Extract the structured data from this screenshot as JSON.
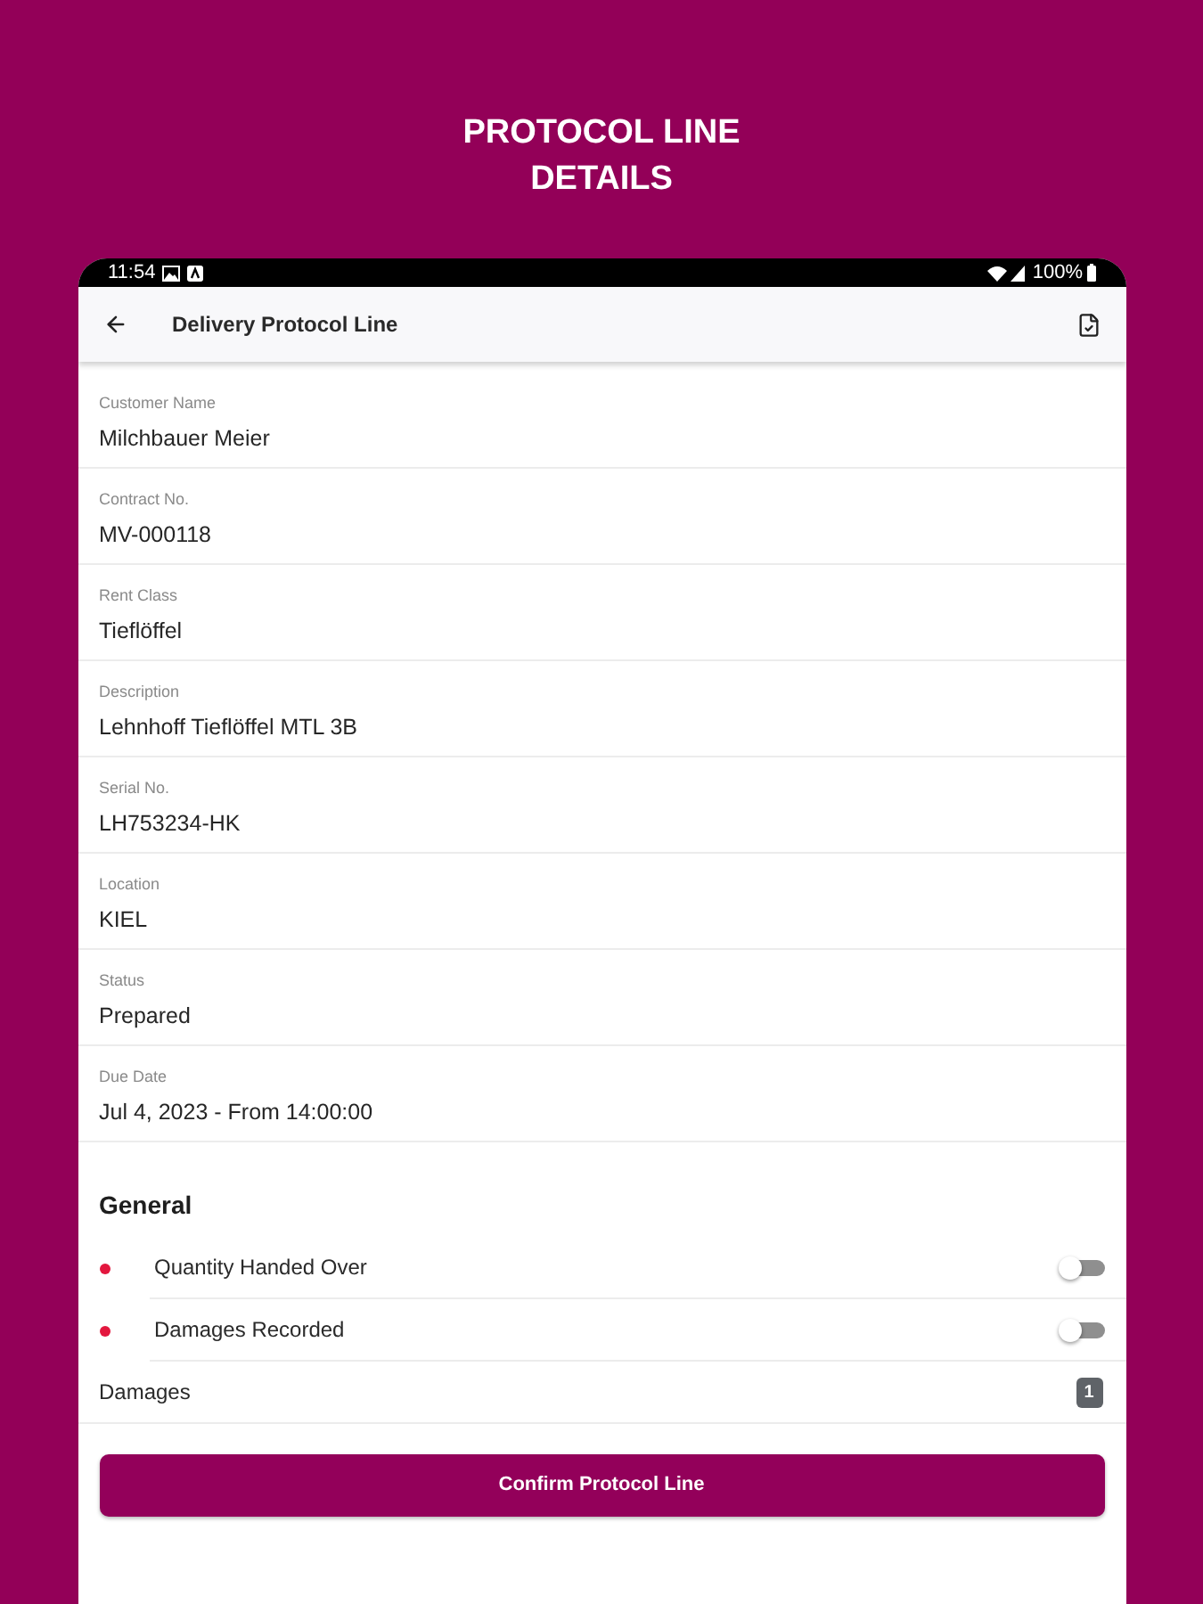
{
  "screen_title": "PROTOCOL LINE DETAILS",
  "status_bar": {
    "time": "11:54",
    "battery": "100%"
  },
  "app_bar": {
    "title": "Delivery Protocol Line"
  },
  "fields": [
    {
      "label": "Customer Name",
      "value": "Milchbauer Meier"
    },
    {
      "label": "Contract No.",
      "value": "MV-000118"
    },
    {
      "label": "Rent Class",
      "value": "Tieflöffel"
    },
    {
      "label": "Description",
      "value": "Lehnhoff Tieflöffel MTL 3B"
    },
    {
      "label": "Serial No.",
      "value": "LH753234-HK"
    },
    {
      "label": "Location",
      "value": "KIEL"
    },
    {
      "label": "Status",
      "value": "Prepared"
    },
    {
      "label": "Due Date",
      "value": "Jul 4, 2023 - From 14:00:00"
    }
  ],
  "general": {
    "heading": "General",
    "rows": [
      {
        "kind": "toggle",
        "label": "Quantity Handed Over",
        "required": true,
        "on": false
      },
      {
        "kind": "toggle",
        "label": "Damages Recorded",
        "required": true,
        "on": false
      },
      {
        "kind": "count",
        "label": "Damages",
        "count": "1"
      }
    ]
  },
  "confirm_button": "Confirm Protocol Line"
}
